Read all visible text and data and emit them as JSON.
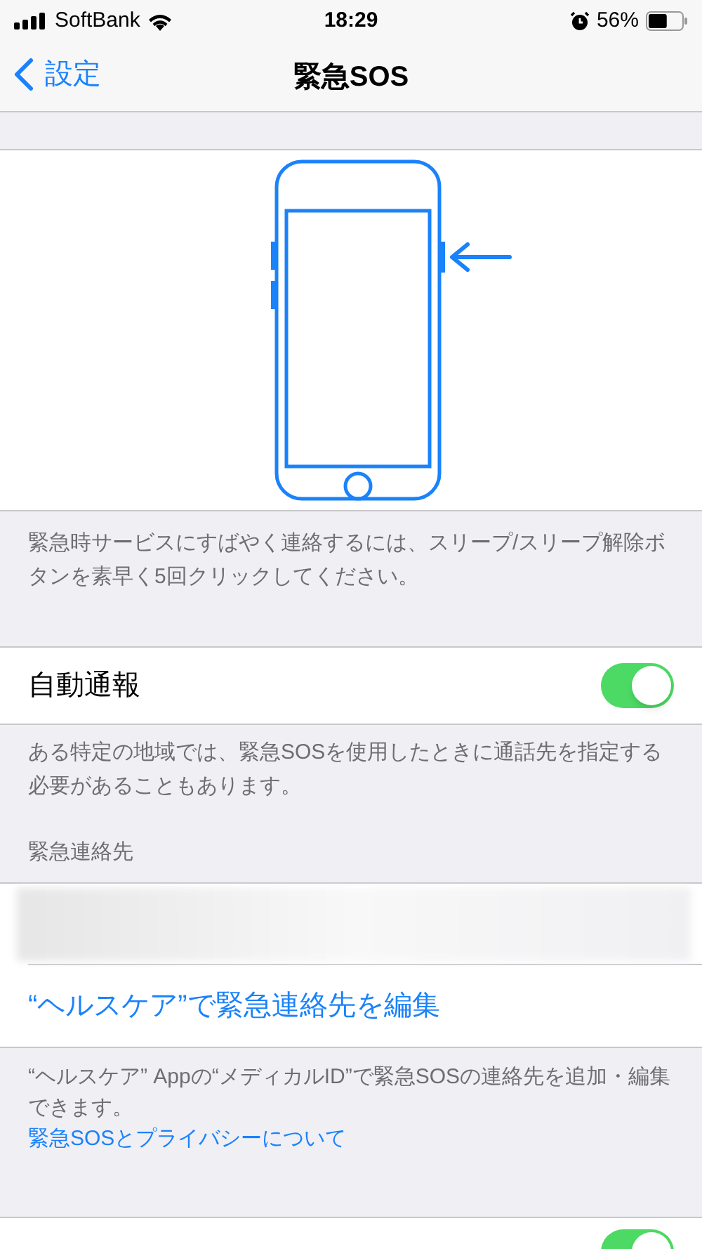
{
  "status_bar": {
    "carrier": "SoftBank",
    "time": "18:29",
    "battery": {
      "text": "56%",
      "level": 0.56
    }
  },
  "nav": {
    "back": "設定",
    "title": "緊急SOS"
  },
  "illustration_caption": "緊急時サービスにすばやく連絡するには、スリープ/スリープ解除ボタンを素早く5回クリックしてください。",
  "auto_call": {
    "label": "自動通報",
    "on": true
  },
  "auto_call_footer": "ある特定の地域では、緊急SOSを使用したときに通話先を指定する必要があることもあります。",
  "contacts": {
    "header": "緊急連絡先",
    "edit_link": "“ヘルスケア”で緊急連絡先を編集",
    "footer": "“ヘルスケア” Appの“メディカルID”で緊急SOSの連絡先を追加・編集できます。",
    "privacy_link": "緊急SOSとプライバシーについて"
  },
  "countdown": {
    "on": true
  }
}
